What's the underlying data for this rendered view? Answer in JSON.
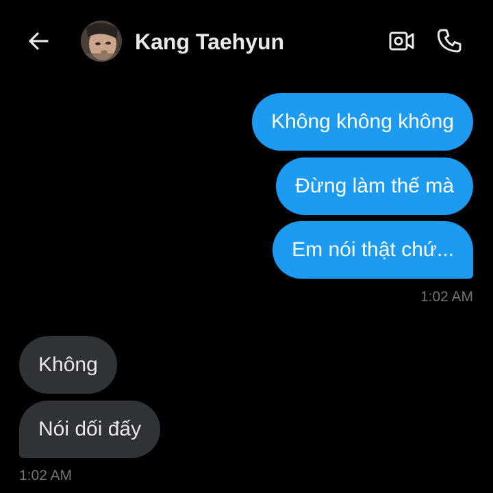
{
  "header": {
    "contact_name": "Kang Taehyun",
    "back_icon": "arrow-left-icon",
    "video_icon": "video-camera-icon",
    "call_icon": "phone-icon"
  },
  "messages": {
    "outgoing": [
      {
        "text": "Không không không"
      },
      {
        "text": "Đừng làm thế mà"
      },
      {
        "text": "Em nói thật chứ..."
      }
    ],
    "outgoing_time": "1:02 AM",
    "incoming": [
      {
        "text": "Không"
      },
      {
        "text": "Nói dối đấy"
      }
    ],
    "incoming_time": "1:02 AM"
  },
  "colors": {
    "background": "#000000",
    "outgoing_bubble": "#1d9bf0",
    "incoming_bubble": "#2f3336",
    "timestamp": "#71767b"
  }
}
